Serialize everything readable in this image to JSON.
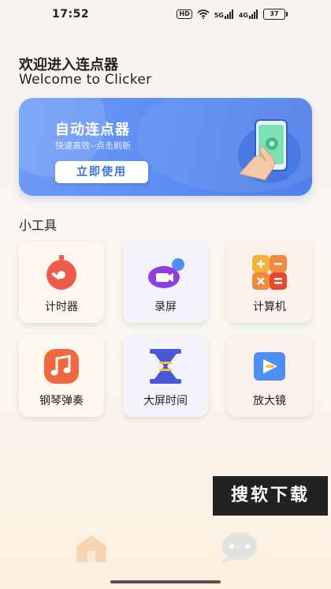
{
  "status_bar": {
    "time": "17:52",
    "hd": "HD",
    "net1": "5G",
    "net2": "4G",
    "battery": "37"
  },
  "welcome": {
    "title_cn": "欢迎进入连点器",
    "title_en": "Welcome to Clicker"
  },
  "banner": {
    "title": "自动连点器",
    "subtitle": "快速高效--点击刷新",
    "button": "立即使用"
  },
  "tools": {
    "title": "小工具",
    "items": [
      {
        "label": "计时器",
        "icon": "stopwatch-icon"
      },
      {
        "label": "录屏",
        "icon": "screen-record-icon"
      },
      {
        "label": "计算机",
        "icon": "calculator-icon"
      },
      {
        "label": "钢琴弹奏",
        "icon": "music-note-icon"
      },
      {
        "label": "大屏时间",
        "icon": "hourglass-icon"
      },
      {
        "label": "放大镜",
        "icon": "play-magnifier-icon"
      }
    ]
  },
  "watermark": "搜软下载",
  "bottom_nav": {
    "items": [
      {
        "icon": "home-icon",
        "active": true
      },
      {
        "icon": "chat-bubble-icon",
        "active": false
      }
    ]
  },
  "colors": {
    "accent_blue": "#5b8cf1",
    "timer_red": "#f05a4a",
    "record_purple": "#8f3ee0",
    "calc_orange": "#f08a3c",
    "piano_orange": "#f2683e",
    "hourglass_indigo": "#4a57d8",
    "magnifier_blue": "#4f8ef5"
  }
}
